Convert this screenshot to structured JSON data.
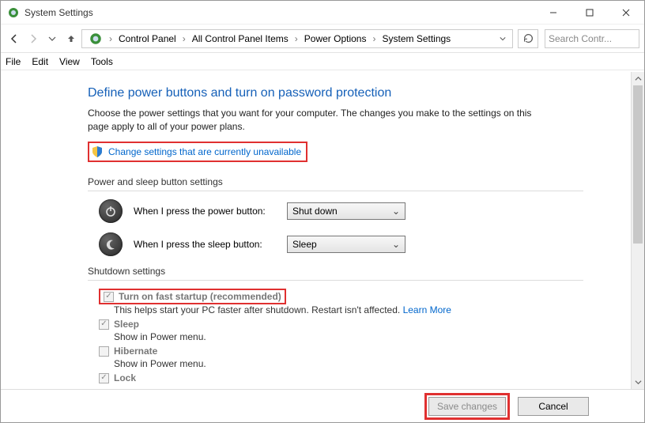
{
  "window": {
    "title": "System Settings"
  },
  "breadcrumbs": {
    "items": [
      "Control Panel",
      "All Control Panel Items",
      "Power Options",
      "System Settings"
    ]
  },
  "search": {
    "placeholder": "Search Contr..."
  },
  "menubar": {
    "file": "File",
    "edit": "Edit",
    "view": "View",
    "tools": "Tools"
  },
  "page": {
    "title": "Define power buttons and turn on password protection",
    "description": "Choose the power settings that you want for your computer. The changes you make to the settings on this page apply to all of your power plans.",
    "change_link": "Change settings that are currently unavailable"
  },
  "power_section": {
    "header": "Power and sleep button settings",
    "power_label": "When I press the power button:",
    "power_value": "Shut down",
    "sleep_label": "When I press the sleep button:",
    "sleep_value": "Sleep"
  },
  "shutdown_section": {
    "header": "Shutdown settings",
    "fast_startup_label": "Turn on fast startup (recommended)",
    "fast_startup_desc_prefix": "This helps start your PC faster after shutdown. Restart isn't affected. ",
    "learn_more": "Learn More",
    "sleep_label": "Sleep",
    "sleep_desc": "Show in Power menu.",
    "hibernate_label": "Hibernate",
    "hibernate_desc": "Show in Power menu.",
    "lock_label": "Lock"
  },
  "footer": {
    "save": "Save changes",
    "cancel": "Cancel"
  }
}
